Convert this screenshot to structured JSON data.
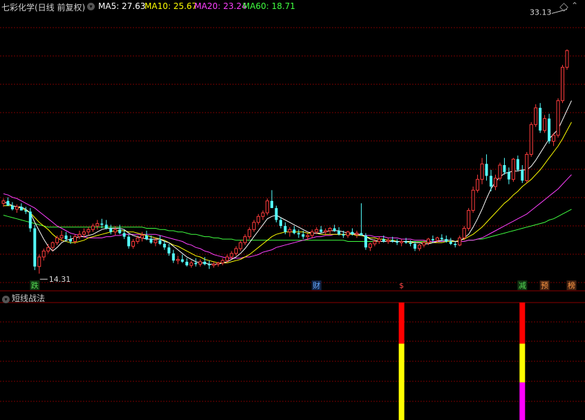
{
  "header": {
    "title": "七彩化学(日线 前复权)",
    "ma5_label": "MA5: 27.63",
    "ma10_label": "MA10: 25.67",
    "ma20_label": "MA20: 23.24",
    "ma60_label": "MA60: 18.71",
    "colors": {
      "title": "#cfcfcf",
      "ma5": "#ffffff",
      "ma10": "#ffff00",
      "ma20": "#ff40ff",
      "ma60": "#40ff40"
    }
  },
  "price_annotations": {
    "high": "33.13",
    "low": "14.31"
  },
  "event_markers": [
    {
      "label": "跌",
      "color": "#55dd55",
      "bg": "#113311"
    },
    {
      "label": "财",
      "color": "#66aaff",
      "bg": "#112244"
    },
    {
      "label": "$",
      "color": "#ff4444",
      "bg": "#000000"
    },
    {
      "label": "减",
      "color": "#55dd55",
      "bg": "#113311"
    },
    {
      "label": "预",
      "color": "#ff9944",
      "bg": "#442211"
    },
    {
      "label": "榜",
      "color": "#ff9944",
      "bg": "#442211"
    }
  ],
  "indicator_panel": {
    "title": "短线战法",
    "icon": "chevron-down-icon"
  },
  "icons": {
    "toolbar": [
      "diamond-icon",
      "arrow-up-icon"
    ]
  },
  "chart_data": {
    "type": "candlestick",
    "ylim": [
      13.5,
      35.5
    ],
    "up_color": "#ff3c3c",
    "down_color": "#54ffff",
    "grid": "dashed red horizontal lines",
    "candles": [
      [
        20.2,
        20.6,
        19.9,
        20.4
      ],
      [
        20.4,
        20.7,
        20.1,
        20.0
      ],
      [
        20.0,
        20.3,
        19.6,
        19.7
      ],
      [
        19.7,
        20.1,
        19.4,
        19.9
      ],
      [
        19.9,
        20.2,
        19.6,
        19.6
      ],
      [
        19.6,
        19.9,
        19.3,
        19.5
      ],
      [
        19.5,
        19.8,
        17.8,
        18.1
      ],
      [
        18.1,
        18.4,
        14.6,
        14.9
      ],
      [
        14.9,
        15.9,
        14.3,
        15.7
      ],
      [
        15.7,
        16.4,
        15.4,
        16.2
      ],
      [
        16.2,
        16.8,
        16.0,
        16.5
      ],
      [
        16.5,
        17.0,
        16.2,
        16.9
      ],
      [
        16.9,
        17.5,
        16.7,
        17.3
      ],
      [
        17.3,
        17.9,
        17.0,
        17.5
      ],
      [
        17.5,
        17.8,
        17.0,
        17.2
      ],
      [
        17.2,
        17.5,
        16.8,
        17.0
      ],
      [
        17.0,
        17.6,
        16.8,
        17.4
      ],
      [
        17.4,
        17.9,
        17.2,
        17.6
      ],
      [
        17.6,
        18.1,
        17.3,
        17.8
      ],
      [
        17.8,
        18.2,
        17.5,
        18.0
      ],
      [
        18.0,
        18.5,
        17.8,
        18.3
      ],
      [
        18.3,
        18.8,
        18.0,
        18.5
      ],
      [
        18.5,
        18.9,
        18.1,
        18.4
      ],
      [
        18.4,
        18.8,
        18.0,
        18.1
      ],
      [
        18.1,
        18.4,
        17.6,
        17.8
      ],
      [
        17.8,
        18.3,
        17.5,
        18.0
      ],
      [
        18.0,
        18.4,
        17.6,
        17.7
      ],
      [
        17.7,
        18.0,
        17.2,
        17.4
      ],
      [
        17.4,
        17.6,
        16.4,
        16.6
      ],
      [
        16.6,
        17.2,
        16.4,
        17.0
      ],
      [
        17.0,
        17.5,
        16.8,
        17.3
      ],
      [
        17.3,
        17.8,
        17.0,
        17.5
      ],
      [
        17.5,
        17.9,
        17.1,
        17.2
      ],
      [
        17.2,
        17.5,
        16.8,
        16.9
      ],
      [
        16.9,
        17.3,
        16.6,
        17.1
      ],
      [
        17.1,
        17.5,
        16.7,
        16.8
      ],
      [
        16.8,
        17.1,
        16.3,
        16.5
      ],
      [
        16.5,
        16.8,
        15.8,
        16.0
      ],
      [
        16.0,
        16.3,
        15.2,
        15.4
      ],
      [
        15.4,
        15.8,
        15.1,
        15.5
      ],
      [
        15.5,
        15.9,
        15.2,
        15.3
      ],
      [
        15.3,
        15.6,
        14.9,
        15.0
      ],
      [
        15.0,
        15.4,
        14.8,
        15.2
      ],
      [
        15.2,
        15.6,
        14.9,
        15.1
      ],
      [
        15.1,
        15.5,
        14.9,
        15.3
      ],
      [
        15.3,
        15.7,
        15.0,
        15.1
      ],
      [
        15.1,
        15.4,
        14.7,
        15.0
      ],
      [
        15.0,
        15.3,
        14.8,
        15.1
      ],
      [
        15.1,
        15.3,
        14.9,
        15.2
      ],
      [
        15.2,
        15.6,
        15.0,
        15.4
      ],
      [
        15.4,
        15.9,
        15.2,
        15.7
      ],
      [
        15.7,
        16.2,
        15.5,
        16.0
      ],
      [
        16.0,
        16.6,
        15.8,
        16.4
      ],
      [
        16.4,
        17.1,
        16.2,
        16.9
      ],
      [
        16.9,
        17.6,
        16.7,
        17.4
      ],
      [
        17.4,
        18.2,
        17.2,
        18.0
      ],
      [
        18.0,
        18.8,
        17.8,
        18.6
      ],
      [
        18.6,
        19.3,
        18.4,
        19.1
      ],
      [
        19.1,
        19.6,
        18.8,
        19.4
      ],
      [
        19.4,
        20.6,
        19.2,
        20.4
      ],
      [
        20.4,
        21.3,
        20.1,
        19.8
      ],
      [
        19.8,
        20.0,
        18.6,
        18.8
      ],
      [
        18.8,
        19.0,
        18.1,
        18.3
      ],
      [
        18.3,
        18.6,
        17.6,
        17.8
      ],
      [
        17.8,
        18.2,
        17.4,
        18.0
      ],
      [
        18.0,
        18.3,
        17.6,
        17.7
      ],
      [
        17.7,
        18.0,
        17.3,
        17.6
      ],
      [
        17.6,
        17.9,
        17.2,
        17.4
      ],
      [
        17.4,
        17.7,
        17.1,
        17.5
      ],
      [
        17.5,
        18.0,
        17.3,
        17.8
      ],
      [
        17.8,
        18.2,
        17.6,
        18.0
      ],
      [
        18.0,
        18.3,
        17.7,
        17.8
      ],
      [
        17.8,
        18.1,
        17.5,
        17.9
      ],
      [
        17.9,
        18.2,
        17.6,
        18.1
      ],
      [
        18.1,
        18.4,
        17.8,
        17.9
      ],
      [
        17.9,
        18.2,
        17.5,
        17.6
      ],
      [
        17.6,
        17.9,
        17.3,
        17.5
      ],
      [
        17.5,
        17.9,
        17.3,
        17.8
      ],
      [
        17.8,
        18.1,
        17.5,
        17.6
      ],
      [
        17.6,
        17.9,
        17.3,
        17.7
      ],
      [
        17.7,
        20.2,
        17.5,
        17.5
      ],
      [
        17.5,
        17.7,
        16.3,
        16.5
      ],
      [
        16.5,
        16.9,
        16.2,
        16.8
      ],
      [
        16.8,
        17.2,
        16.6,
        17.0
      ],
      [
        17.0,
        17.4,
        16.8,
        17.2
      ],
      [
        17.2,
        17.5,
        16.9,
        17.0
      ],
      [
        17.0,
        17.3,
        16.8,
        17.1
      ],
      [
        17.1,
        17.4,
        16.9,
        17.0
      ],
      [
        17.0,
        17.2,
        16.7,
        16.9
      ],
      [
        16.9,
        17.2,
        16.6,
        17.0
      ],
      [
        17.0,
        17.3,
        16.8,
        16.9
      ],
      [
        16.9,
        17.1,
        16.6,
        16.8
      ],
      [
        16.8,
        17.0,
        16.2,
        16.4
      ],
      [
        16.4,
        16.8,
        16.2,
        16.7
      ],
      [
        16.7,
        17.1,
        16.5,
        16.9
      ],
      [
        16.9,
        17.3,
        16.7,
        17.2
      ],
      [
        17.2,
        17.5,
        16.9,
        17.1
      ],
      [
        17.1,
        17.4,
        16.9,
        17.3
      ],
      [
        17.3,
        17.6,
        17.0,
        17.2
      ],
      [
        17.2,
        17.5,
        16.9,
        17.0
      ],
      [
        17.0,
        17.3,
        16.7,
        16.8
      ],
      [
        16.8,
        17.0,
        16.5,
        16.7
      ],
      [
        16.7,
        17.5,
        16.6,
        17.3
      ],
      [
        17.3,
        18.3,
        17.1,
        18.1
      ],
      [
        18.1,
        19.8,
        17.9,
        19.6
      ],
      [
        19.6,
        21.6,
        19.4,
        21.3
      ],
      [
        21.3,
        22.6,
        21.1,
        22.2
      ],
      [
        22.2,
        24.0,
        21.8,
        23.5
      ],
      [
        23.5,
        24.3,
        22.1,
        22.5
      ],
      [
        22.5,
        23.0,
        21.2,
        21.6
      ],
      [
        21.6,
        22.6,
        21.3,
        22.3
      ],
      [
        22.3,
        23.6,
        22.1,
        23.4
      ],
      [
        23.4,
        24.0,
        22.6,
        22.8
      ],
      [
        22.8,
        23.2,
        21.8,
        22.2
      ],
      [
        22.2,
        24.0,
        22.0,
        23.9
      ],
      [
        23.9,
        24.2,
        22.9,
        23.0
      ],
      [
        23.0,
        23.4,
        21.9,
        22.1
      ],
      [
        22.1,
        24.5,
        21.9,
        24.3
      ],
      [
        24.3,
        27.0,
        24.1,
        26.8
      ],
      [
        26.8,
        28.5,
        26.6,
        28.2
      ],
      [
        28.2,
        28.6,
        26.1,
        26.3
      ],
      [
        26.3,
        27.6,
        26.1,
        27.3
      ],
      [
        27.3,
        27.7,
        25.2,
        25.4
      ],
      [
        25.4,
        26.1,
        25.0,
        25.9
      ],
      [
        25.9,
        29.0,
        25.7,
        28.8
      ],
      [
        28.8,
        31.8,
        28.6,
        31.6
      ],
      [
        31.6,
        33.1,
        31.4,
        33.0
      ]
    ],
    "ma5": [
      20.3,
      20.2,
      20.0,
      19.9,
      19.9,
      19.7,
      19.4,
      18.6,
      17.9,
      17.2,
      16.6,
      16.2,
      16.5,
      16.9,
      17.1,
      17.2,
      17.3,
      17.4,
      17.4,
      17.5,
      17.6,
      17.8,
      18.0,
      18.1,
      18.1,
      18.1,
      18.1,
      18.0,
      17.7,
      17.5,
      17.4,
      17.3,
      17.2,
      17.2,
      17.2,
      17.2,
      17.0,
      16.9,
      16.6,
      16.3,
      16.0,
      15.7,
      15.5,
      15.3,
      15.2,
      15.2,
      15.1,
      15.1,
      15.1,
      15.2,
      15.3,
      15.5,
      15.7,
      16.0,
      16.4,
      16.9,
      17.4,
      17.9,
      18.4,
      18.9,
      19.1,
      19.2,
      19.0,
      18.8,
      18.6,
      18.4,
      18.2,
      18.0,
      17.8,
      17.7,
      17.7,
      17.7,
      17.8,
      17.9,
      17.9,
      17.9,
      17.8,
      17.7,
      17.7,
      17.6,
      17.6,
      17.4,
      17.2,
      17.1,
      17.0,
      17.0,
      17.0,
      17.0,
      17.0,
      17.0,
      17.0,
      17.0,
      16.9,
      16.9,
      16.8,
      16.8,
      16.9,
      17.0,
      17.1,
      17.1,
      17.1,
      17.0,
      17.0,
      17.3,
      17.6,
      18.2,
      18.9,
      19.7,
      20.6,
      21.4,
      22.0,
      22.4,
      22.7,
      22.8,
      22.9,
      22.9,
      23.0,
      23.0,
      23.3,
      23.8,
      24.4,
      25.0,
      25.6,
      26.0,
      26.4,
      27.2,
      28.0,
      28.8
    ],
    "ma10": [
      20.0,
      20.0,
      20.0,
      19.9,
      19.8,
      19.6,
      19.4,
      19.0,
      18.6,
      18.3,
      18.0,
      17.6,
      17.3,
      17.1,
      17.0,
      16.9,
      16.9,
      17.0,
      17.1,
      17.3,
      17.4,
      17.5,
      17.6,
      17.7,
      17.8,
      17.9,
      17.9,
      17.9,
      17.8,
      17.8,
      17.7,
      17.6,
      17.5,
      17.4,
      17.3,
      17.2,
      17.1,
      16.9,
      16.7,
      16.6,
      16.4,
      16.2,
      16.0,
      15.8,
      15.7,
      15.5,
      15.4,
      15.3,
      15.2,
      15.2,
      15.2,
      15.3,
      15.4,
      15.5,
      15.7,
      15.9,
      16.2,
      16.5,
      16.8,
      17.1,
      17.4,
      17.6,
      17.7,
      17.8,
      17.8,
      17.8,
      17.8,
      17.8,
      17.7,
      17.7,
      17.7,
      17.6,
      17.6,
      17.6,
      17.6,
      17.6,
      17.6,
      17.6,
      17.6,
      17.5,
      17.5,
      17.4,
      17.3,
      17.3,
      17.2,
      17.2,
      17.1,
      17.1,
      17.0,
      17.0,
      17.0,
      16.9,
      16.9,
      16.9,
      16.9,
      16.9,
      16.9,
      16.9,
      16.9,
      17.0,
      17.0,
      17.0,
      17.1,
      17.2,
      17.4,
      17.6,
      17.9,
      18.2,
      18.6,
      19.0,
      19.4,
      19.8,
      20.2,
      20.5,
      20.9,
      21.2,
      21.6,
      21.9,
      22.2,
      22.6,
      23.0,
      23.5,
      24.0,
      24.5,
      25.0,
      25.6,
      26.3,
      27.0
    ],
    "ma20": [
      21.0,
      20.9,
      20.7,
      20.6,
      20.4,
      20.2,
      20.0,
      19.8,
      19.5,
      19.2,
      18.9,
      18.6,
      18.3,
      18.1,
      17.9,
      17.7,
      17.6,
      17.5,
      17.4,
      17.3,
      17.3,
      17.3,
      17.3,
      17.4,
      17.4,
      17.5,
      17.5,
      17.6,
      17.6,
      17.6,
      17.6,
      17.6,
      17.6,
      17.6,
      17.6,
      17.5,
      17.4,
      17.3,
      17.2,
      17.1,
      17.0,
      16.8,
      16.7,
      16.5,
      16.4,
      16.2,
      16.1,
      15.9,
      15.8,
      15.7,
      15.6,
      15.6,
      15.6,
      15.6,
      15.7,
      15.7,
      15.8,
      15.9,
      16.1,
      16.2,
      16.3,
      16.5,
      16.6,
      16.7,
      16.8,
      16.9,
      17.0,
      17.1,
      17.2,
      17.3,
      17.4,
      17.4,
      17.5,
      17.5,
      17.6,
      17.6,
      17.6,
      17.6,
      17.6,
      17.6,
      17.5,
      17.5,
      17.5,
      17.4,
      17.4,
      17.4,
      17.3,
      17.3,
      17.3,
      17.2,
      17.2,
      17.2,
      17.1,
      17.1,
      17.1,
      17.0,
      17.0,
      17.0,
      17.0,
      17.0,
      17.0,
      17.0,
      17.0,
      17.0,
      17.1,
      17.1,
      17.2,
      17.3,
      17.5,
      17.7,
      17.9,
      18.1,
      18.3,
      18.5,
      18.7,
      18.9,
      19.1,
      19.3,
      19.6,
      19.9,
      20.2,
      20.5,
      20.8,
      21.1,
      21.4,
      21.8,
      22.2,
      22.6
    ],
    "ma60": [
      19.2,
      19.1,
      19.0,
      18.9,
      18.8,
      18.7,
      18.6,
      18.5,
      18.4,
      18.3,
      18.2,
      18.2,
      18.2,
      18.2,
      18.2,
      18.2,
      18.2,
      18.2,
      18.2,
      18.2,
      18.2,
      18.2,
      18.2,
      18.2,
      18.2,
      18.2,
      18.2,
      18.2,
      18.2,
      18.2,
      18.2,
      18.2,
      18.1,
      18.1,
      18.1,
      18.0,
      18.0,
      17.9,
      17.9,
      17.8,
      17.8,
      17.7,
      17.6,
      17.6,
      17.5,
      17.4,
      17.4,
      17.3,
      17.3,
      17.2,
      17.2,
      17.2,
      17.1,
      17.1,
      17.1,
      17.1,
      17.1,
      17.1,
      17.1,
      17.1,
      17.1,
      17.1,
      17.1,
      17.1,
      17.1,
      17.1,
      17.1,
      17.1,
      17.1,
      17.1,
      17.1,
      17.1,
      17.1,
      17.1,
      17.1,
      17.1,
      17.1,
      17.0,
      17.0,
      17.0,
      17.0,
      17.0,
      17.0,
      17.0,
      17.0,
      17.0,
      17.0,
      17.0,
      17.0,
      17.0,
      17.0,
      17.0,
      17.0,
      17.0,
      17.0,
      17.0,
      17.0,
      17.0,
      17.0,
      17.0,
      17.0,
      17.0,
      17.0,
      17.0,
      17.1,
      17.1,
      17.2,
      17.2,
      17.3,
      17.4,
      17.5,
      17.6,
      17.7,
      17.8,
      17.9,
      18.0,
      18.1,
      18.2,
      18.3,
      18.4,
      18.5,
      18.6,
      18.8,
      18.9,
      19.1,
      19.3,
      19.5,
      19.7
    ],
    "markers_at_candle": [
      7,
      70,
      89,
      116,
      121,
      127
    ],
    "indicator_bars": [
      {
        "candle": 89,
        "segments": [
          {
            "color": "#ff0000",
            "from": 0.0,
            "to": 0.35
          },
          {
            "color": "#ffff00",
            "from": 0.35,
            "to": 1.0
          }
        ]
      },
      {
        "candle": 116,
        "segments": [
          {
            "color": "#ff0000",
            "from": 0.0,
            "to": 0.35
          },
          {
            "color": "#ffff00",
            "from": 0.35,
            "to": 0.68
          },
          {
            "color": "#ff00ff",
            "from": 0.68,
            "to": 1.0
          }
        ]
      }
    ]
  }
}
